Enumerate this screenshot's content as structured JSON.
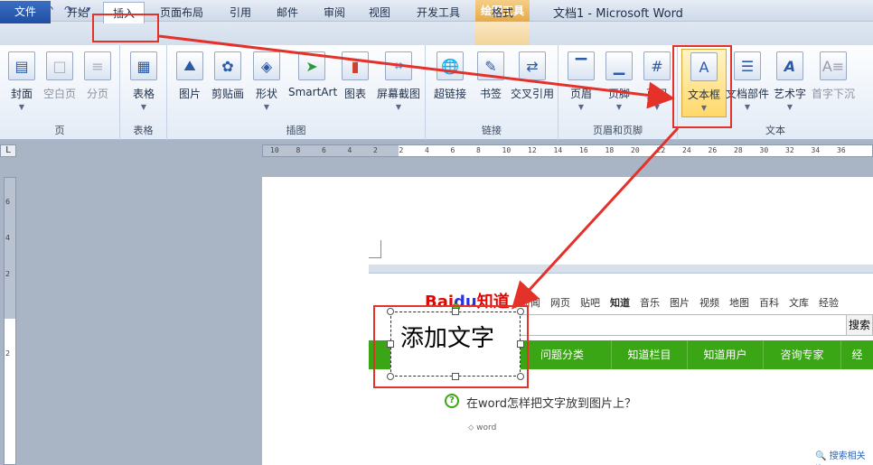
{
  "window": {
    "title": "文档1  -  Microsoft Word",
    "context_title": "绘图工具"
  },
  "quick_access": {
    "word_icon": "W"
  },
  "tabs": [
    "文件",
    "开始",
    "插入",
    "页面布局",
    "引用",
    "邮件",
    "审阅",
    "视图",
    "开发工具",
    "格式"
  ],
  "active_tab": "插入",
  "ribbon": {
    "groups": [
      {
        "label": "页",
        "buttons": [
          {
            "label": "封面",
            "icon": "cover-page-icon",
            "dim": false
          },
          {
            "label": "空白页",
            "icon": "blank-page-icon",
            "dim": true
          },
          {
            "label": "分页",
            "icon": "page-break-icon",
            "dim": true
          }
        ]
      },
      {
        "label": "表格",
        "buttons": [
          {
            "label": "表格",
            "icon": "table-icon",
            "dim": false
          }
        ]
      },
      {
        "label": "插图",
        "buttons": [
          {
            "label": "图片",
            "icon": "picture-icon",
            "dim": false
          },
          {
            "label": "剪贴画",
            "icon": "clipart-icon",
            "dim": false
          },
          {
            "label": "形状",
            "icon": "shapes-icon",
            "dim": false
          },
          {
            "label": "SmartArt",
            "icon": "smartart-icon",
            "dim": false
          },
          {
            "label": "图表",
            "icon": "chart-icon",
            "dim": false
          },
          {
            "label": "屏幕截图",
            "icon": "screenshot-icon",
            "dim": false
          }
        ]
      },
      {
        "label": "链接",
        "buttons": [
          {
            "label": "超链接",
            "icon": "hyperlink-icon",
            "dim": false
          },
          {
            "label": "书签",
            "icon": "bookmark-icon",
            "dim": false
          },
          {
            "label": "交叉引用",
            "icon": "cross-reference-icon",
            "dim": false
          }
        ]
      },
      {
        "label": "页眉和页脚",
        "buttons": [
          {
            "label": "页眉",
            "icon": "header-icon",
            "dim": false
          },
          {
            "label": "页脚",
            "icon": "footer-icon",
            "dim": false
          },
          {
            "label": "页码",
            "icon": "page-number-icon",
            "dim": false
          }
        ]
      },
      {
        "label": "文本",
        "buttons": [
          {
            "label": "文本框",
            "icon": "textbox-icon",
            "dim": false
          },
          {
            "label": "文档部件",
            "icon": "quick-parts-icon",
            "dim": false
          },
          {
            "label": "艺术字",
            "icon": "wordart-icon",
            "dim": false
          },
          {
            "label": "首字下沉",
            "icon": "drop-cap-icon",
            "dim": true
          }
        ]
      }
    ]
  },
  "ruler": {
    "h_ticks": [
      "10",
      "8",
      "6",
      "4",
      "2",
      "2",
      "4",
      "6",
      "8",
      "10",
      "12",
      "14",
      "16",
      "18",
      "20",
      "22",
      "24",
      "26",
      "28",
      "30",
      "32",
      "34",
      "36"
    ],
    "v_ticks": [
      "6",
      "4",
      "2",
      "2"
    ]
  },
  "embedded_image": {
    "logo_left": "Bai",
    "logo_du": "du",
    "logo_right": "知道",
    "nav": [
      "新闻",
      "网页",
      "贴吧",
      "知道",
      "音乐",
      "图片",
      "视频",
      "地图",
      "百科",
      "文库",
      "经验"
    ],
    "search_button": "搜索",
    "green_tabs": [
      "问题分类",
      "知道栏目",
      "知道用户",
      "咨询专家",
      "经"
    ],
    "question": "在word怎样把文字放到图片上？",
    "tag": "word",
    "more": "搜索相关资"
  },
  "textbox": {
    "text": "添加文字"
  },
  "colors": {
    "annotation_red": "#e4322b",
    "file_tab_blue": "#1f4fa5",
    "baidu_green": "#3aa515",
    "highlight_yellow": "#ffd86a"
  }
}
